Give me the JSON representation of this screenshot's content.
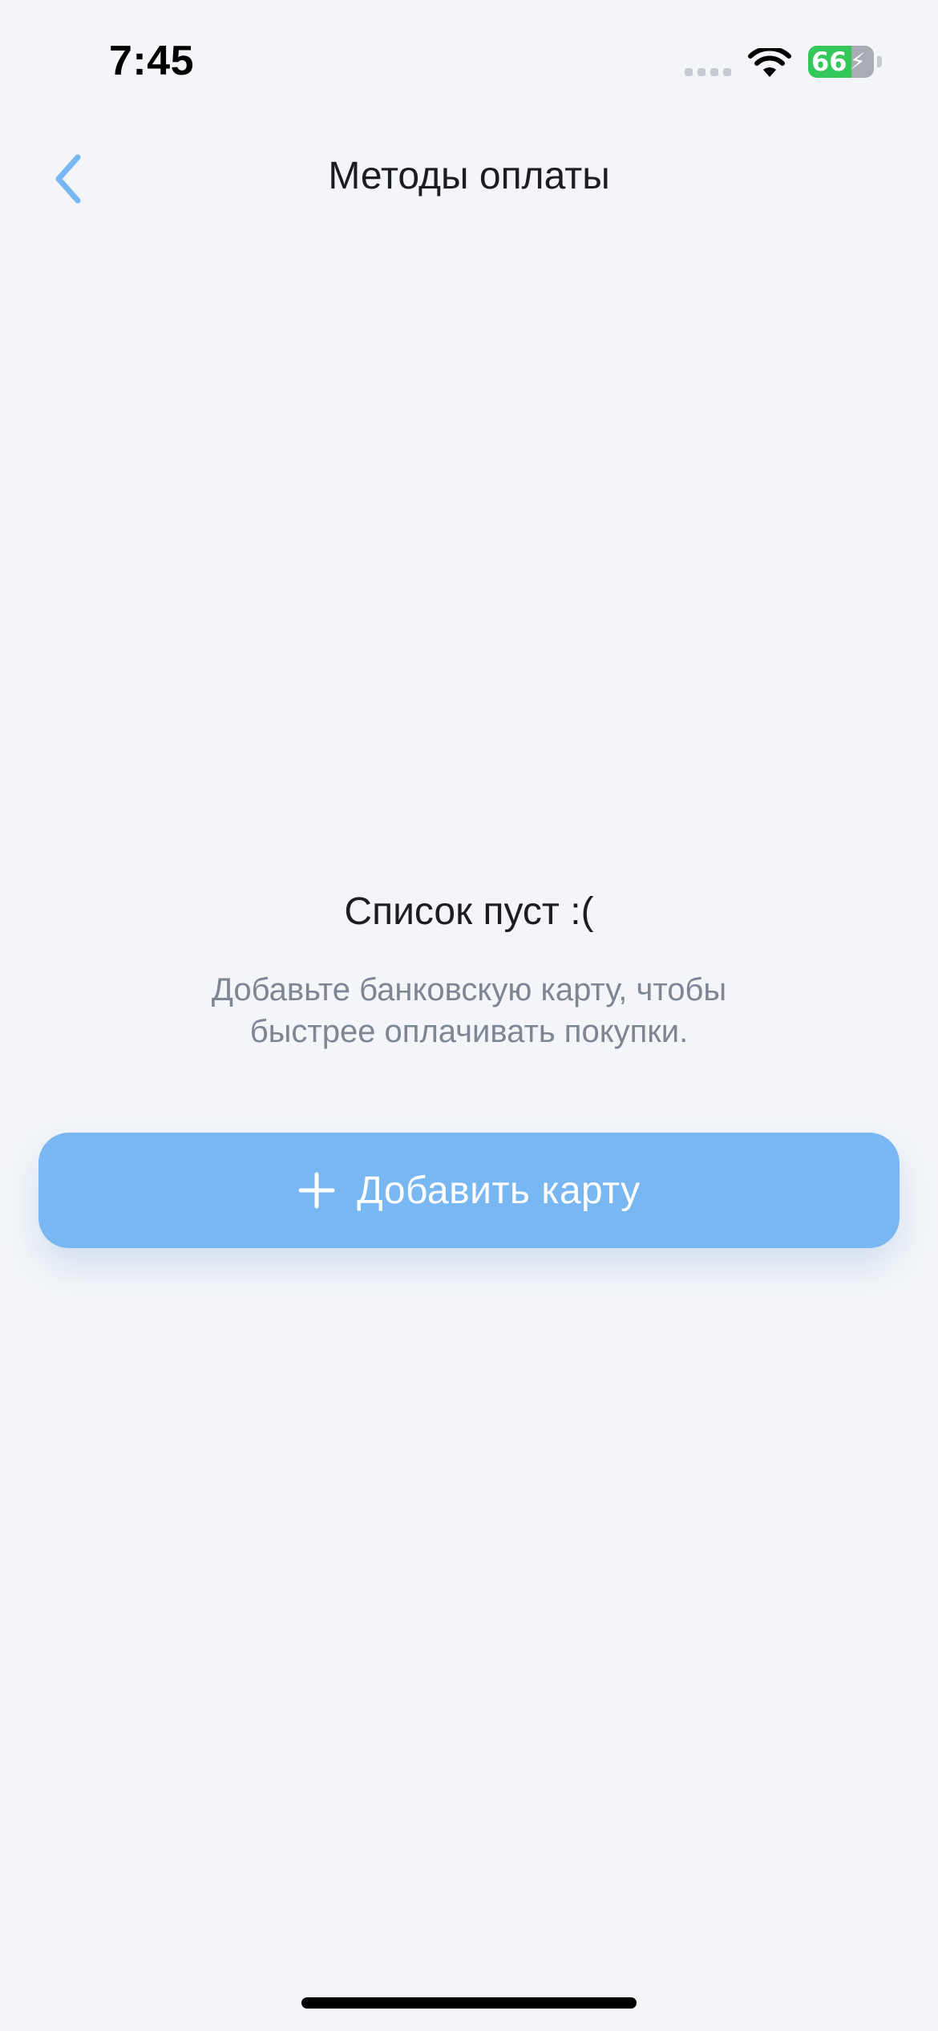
{
  "status_bar": {
    "time": "7:45",
    "battery_percent": "66",
    "battery_level": 0.66,
    "icons": [
      "cellular-signal-icon",
      "wifi-icon",
      "battery-charging-icon"
    ]
  },
  "header": {
    "title": "Методы оплаты",
    "back_icon": "chevron-left-icon"
  },
  "empty_state": {
    "title": "Список пуст :(",
    "description": "Добавьте банковскую карту, чтобы быстрее оплачивать покупки."
  },
  "actions": {
    "add_card_label": "Добавить карту",
    "add_card_icon": "plus-icon"
  },
  "colors": {
    "background": "#F3F5F8",
    "accent": "#78B7F2",
    "battery_green": "#34C759",
    "title_text": "#1C1D20",
    "secondary_text": "#7E8593"
  }
}
